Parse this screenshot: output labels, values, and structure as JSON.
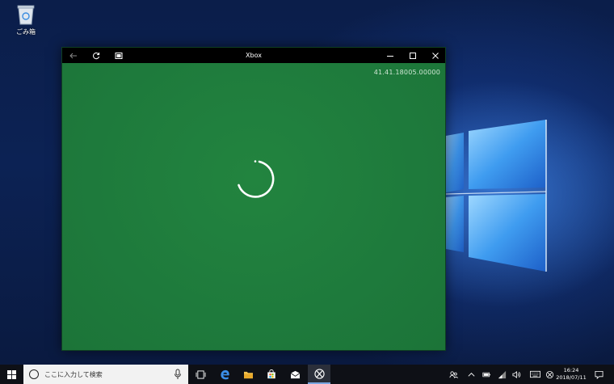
{
  "desktop": {
    "recycle_bin_label": "ごみ箱"
  },
  "window": {
    "title": "Xbox",
    "version": "41.41.18005.00000",
    "state": "loading",
    "colors": {
      "body": "#1e7a3c",
      "titlebar": "#000000"
    },
    "toolbar_icons": [
      "back-arrow-icon",
      "refresh-icon",
      "snapshot-icon"
    ],
    "controls": [
      "minimize-icon",
      "maximize-icon",
      "close-icon"
    ]
  },
  "taskbar": {
    "search_placeholder": "ここに入力して検索",
    "pinned": [
      "start-icon",
      "cortana-icon",
      "microphone-icon",
      "task-view-icon",
      "edge-icon",
      "file-explorer-icon",
      "store-icon",
      "mail-icon",
      "xbox-icon"
    ],
    "tray": [
      "people-icon",
      "chevron-up-icon",
      "battery-icon",
      "network-icon",
      "volume-icon",
      "keyboard-icon",
      "ime-icon",
      "notification-icon"
    ],
    "clock": {
      "time": "16:24",
      "date": "2018/07/11"
    }
  }
}
